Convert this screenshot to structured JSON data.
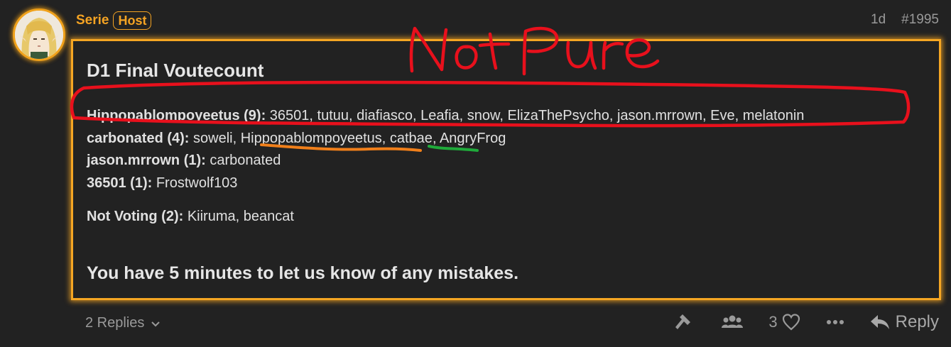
{
  "author": {
    "name": "Serie",
    "badge": "Host"
  },
  "meta": {
    "age": "1d",
    "post_number": "#1995"
  },
  "post": {
    "title": "D1 Final Voutecount",
    "votes": [
      {
        "target": "Hippopablompoyeetus (9):",
        "voters": " 36501, tutuu, diafiasco, Leafia, snow, ElizaThePsycho, jason.mrrown, Eve, melatonin"
      },
      {
        "target": "carbonated (4):",
        "voters_pre": " soweli, ",
        "voter_orange": "Hippopablompoyeetus",
        "sep": ", ",
        "voter_green": "catbae",
        "voters_post": ", AngryFrog"
      },
      {
        "target": "jason.mrrown (1):",
        "voters": " carbonated"
      },
      {
        "target": "36501 (1):",
        "voters": " Frostwolf103"
      }
    ],
    "not_voting": {
      "label": "Not Voting (2):",
      "names": " Kiiruma, beancat"
    },
    "closing": "You have 5 minutes to let us know of any mistakes."
  },
  "annotation": {
    "handwritten_text": "Not Pure",
    "colors": {
      "red": "#e8101c",
      "orange": "#f07f1a",
      "green": "#1faa3a"
    }
  },
  "footer": {
    "replies_label": "2 Replies",
    "like_count": "3",
    "reply_label": "Reply"
  },
  "colors": {
    "accent": "#f5a623",
    "background": "#222222",
    "text": "#e0e0e0",
    "muted": "#9a9a9a"
  },
  "icons": [
    "chevron-down-icon",
    "hammer-icon",
    "users-icon",
    "heart-icon",
    "ellipsis-icon",
    "reply-arrow-icon"
  ]
}
